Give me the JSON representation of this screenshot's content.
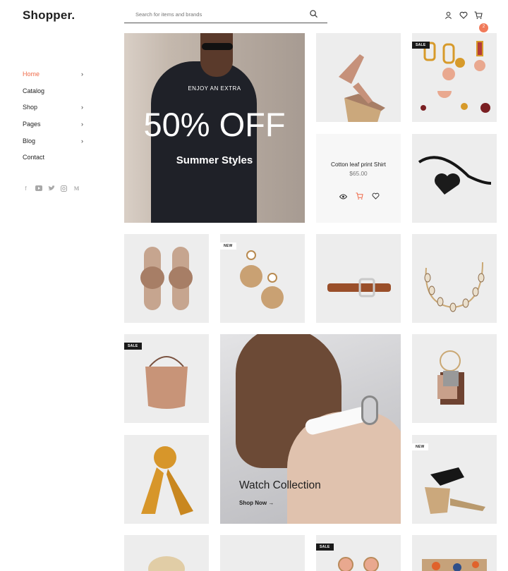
{
  "brand": {
    "logo": "Shopper."
  },
  "search": {
    "placeholder": "Search for items and brands"
  },
  "header": {
    "cart_count": "2"
  },
  "nav": {
    "items": [
      {
        "label": "Home",
        "active": true,
        "chevron": true
      },
      {
        "label": "Catalog",
        "active": false,
        "chevron": false
      },
      {
        "label": "Shop",
        "active": false,
        "chevron": true
      },
      {
        "label": "Pages",
        "active": false,
        "chevron": true
      },
      {
        "label": "Blog",
        "active": false,
        "chevron": true
      },
      {
        "label": "Contact",
        "active": false,
        "chevron": false
      }
    ]
  },
  "social": [
    "facebook-icon",
    "youtube-icon",
    "twitter-icon",
    "instagram-icon",
    "medium-icon"
  ],
  "hero": {
    "eyebrow": "ENJOY AN EXTRA",
    "headline": "50% OFF",
    "subhead": "Summer Styles"
  },
  "quickview": {
    "name": "Cotton leaf print Shirt",
    "price": "$65.00"
  },
  "feature": {
    "title": "Watch Collection",
    "cta": "Shop Now"
  },
  "tags": {
    "sale": "SALE",
    "new": "NEW"
  },
  "colors": {
    "accent": "#ef6b4a",
    "dark": "#1a1a1a",
    "tile": "#ededed"
  }
}
